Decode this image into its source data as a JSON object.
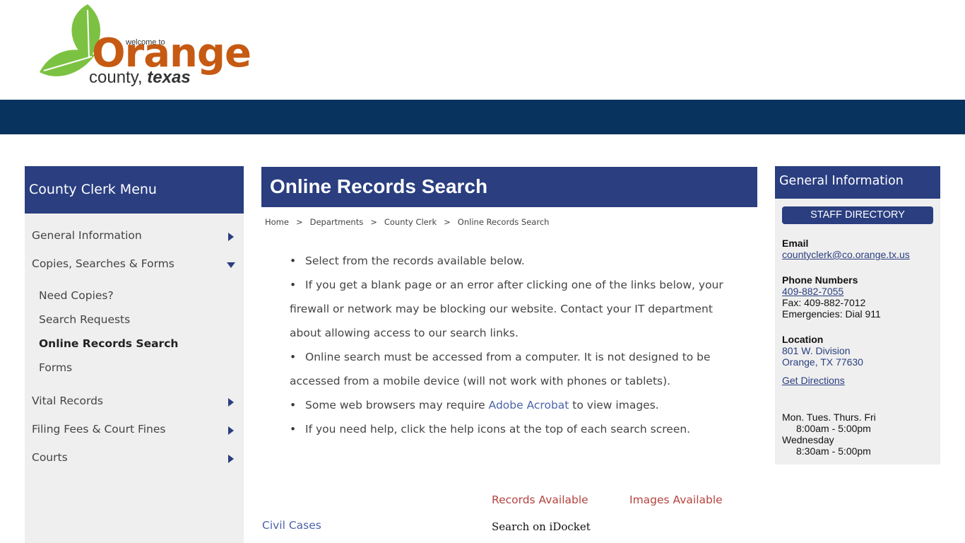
{
  "logo": {
    "welcome": "welcome to",
    "name": "Orange",
    "county": "county,",
    "state": "texas"
  },
  "sidebar": {
    "title": "County Clerk Menu",
    "items": [
      {
        "label": "General Information"
      },
      {
        "label": "Copies, Searches & Forms"
      },
      {
        "label": "Vital Records"
      },
      {
        "label": "Filing Fees & Court Fines"
      },
      {
        "label": "Courts"
      }
    ],
    "submenu": [
      {
        "label": "Need Copies?"
      },
      {
        "label": "Search Requests"
      },
      {
        "label": "Online Records Search"
      },
      {
        "label": "Forms"
      }
    ]
  },
  "main": {
    "title": "Online Records Search",
    "breadcrumb": [
      "Home",
      "Departments",
      "County Clerk",
      "Online Records Search"
    ],
    "bullets": {
      "b1": "Select from the records available below.",
      "b2": "If you get a blank page or an error after clicking one of the links below, your firewall or network may be blocking our website.  Contact your IT department about allowing access to our search links.",
      "b3": "Online search must be accessed from a computer.  It is not designed to be accessed from a mobile device (will not work with phones or tablets).",
      "b4_pre": "Some web browsers may require ",
      "b4_link": "Adobe Acrobat",
      "b4_post": " to view images.",
      "b5": "If you need help, click the help icons at the top of each search screen."
    },
    "table": {
      "col1": "Records Available",
      "col2": "Images Available",
      "row_label": "Civil Cases",
      "row_value": "Search on iDocket"
    }
  },
  "info": {
    "title": "General Information",
    "staff_button": "STAFF DIRECTORY",
    "email_label": "Email",
    "email": "countyclerk@co.orange.tx.us",
    "phone_label": "Phone Numbers",
    "phone": "409-882-7055",
    "fax": "Fax: 409-882-7012",
    "emergency": "Emergencies: Dial 911",
    "location_label": "Location",
    "address1": "801 W. Division",
    "address2": "Orange, TX 77630",
    "directions": "Get Directions",
    "hours1_days": "Mon. Tues. Thurs. Fri",
    "hours1_time": "8:00am - 5:00pm",
    "hours2_days": "Wednesday",
    "hours2_time": "8:30am - 5:00pm"
  },
  "colors": {
    "navy": "#08335e",
    "blue": "#2a3e80",
    "orange": "#c65a12",
    "green": "#7cc242"
  }
}
